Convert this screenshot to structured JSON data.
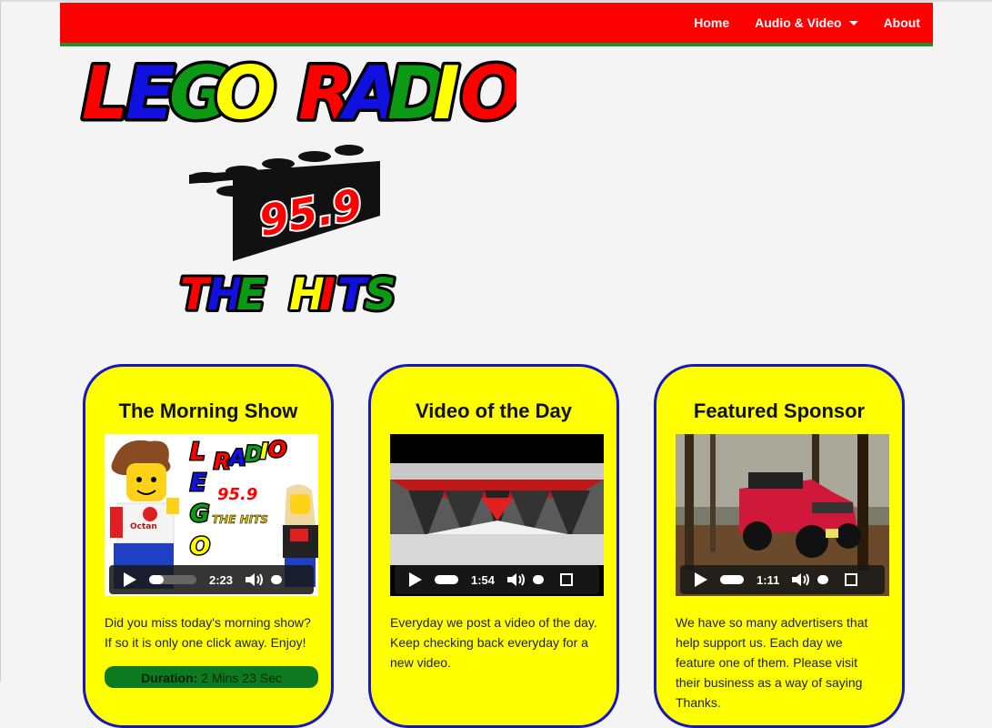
{
  "nav": {
    "items": [
      {
        "label": "Home"
      },
      {
        "label": "Audio & Video",
        "has_dropdown": true
      },
      {
        "label": "About"
      }
    ],
    "background": "#ff0000",
    "accent": "#1f8f2e"
  },
  "logo": {
    "line1_word1": "LEGO",
    "line1_word2": "RADIO",
    "frequency": "95.9",
    "tagline": "THE HITS"
  },
  "cards": [
    {
      "title": "The Morning Show",
      "media_type": "audio",
      "thumb_logo_line1": "RADIO",
      "thumb_logo_frequency": "95.9",
      "thumb_logo_tagline": "THE HITS",
      "thumb_logo_vertical": "LEGO",
      "thumb_shirt": "Octan",
      "player_time": "2:23",
      "text": "Did you miss today's morning show? If so it is only one click away. Enjoy!",
      "duration_label": "Duration:",
      "duration_value": "2 Mins 23 Sec"
    },
    {
      "title": "Video of the Day",
      "media_type": "video",
      "player_time": "1:54",
      "text": "Everyday we post a video of the day. Keep checking back everyday for a new video."
    },
    {
      "title": "Featured Sponsor",
      "media_type": "video",
      "player_time": "1:11",
      "text": "We have so many advertisers that help support us. Each day we feature one of them. Please visit their business as a way of saying Thanks."
    }
  ],
  "colors": {
    "card_bg": "#ffff00",
    "card_border": "#1616c4",
    "duration_bar": "#0d7a20"
  }
}
